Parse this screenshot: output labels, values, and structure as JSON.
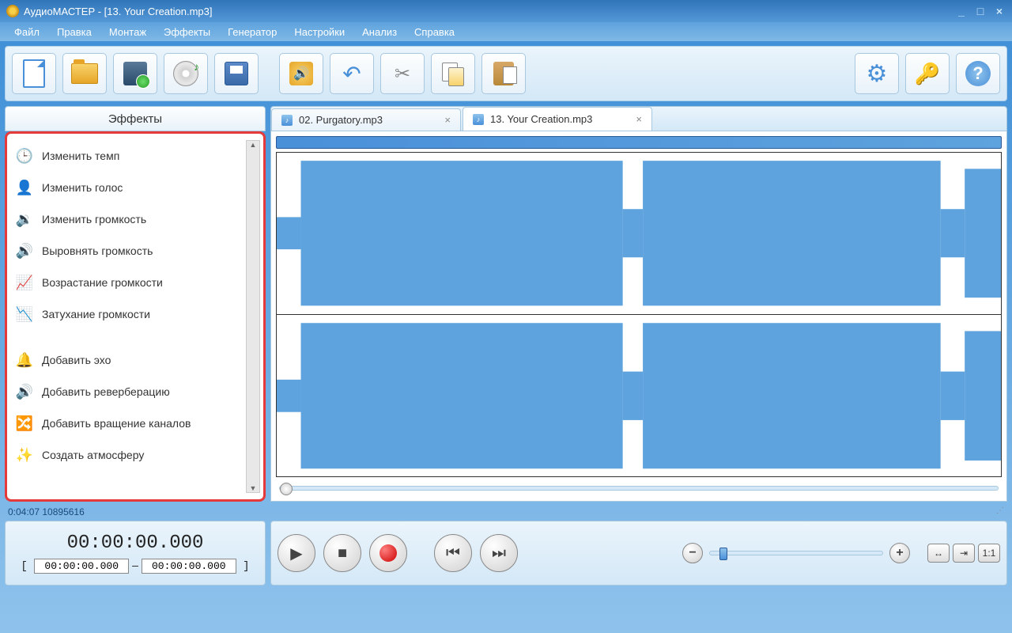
{
  "window": {
    "title": "АудиоМАСТЕР - [13. Your Creation.mp3]"
  },
  "menu": {
    "items": [
      "Файл",
      "Правка",
      "Монтаж",
      "Эффекты",
      "Генератор",
      "Настройки",
      "Анализ",
      "Справка"
    ]
  },
  "toolbar": {
    "new": "new",
    "open": "open",
    "video": "video",
    "cd": "cd",
    "save": "save",
    "speaker": "speaker",
    "undo": "undo",
    "cut": "cut",
    "copy": "copy",
    "paste": "paste",
    "settings": "settings",
    "keys": "keys",
    "help": "help"
  },
  "effects": {
    "header": "Эффекты",
    "items": [
      {
        "icon": "🕒",
        "label": "Изменить темп"
      },
      {
        "icon": "👤",
        "label": "Изменить голос"
      },
      {
        "icon": "🔉",
        "label": "Изменить громкость"
      },
      {
        "icon": "🔊",
        "label": "Выровнять громкость"
      },
      {
        "icon": "📈",
        "label": "Возрастание громкости"
      },
      {
        "icon": "📉",
        "label": "Затухание громкости"
      }
    ],
    "items2": [
      {
        "icon": "🔔",
        "label": "Добавить эхо"
      },
      {
        "icon": "🔊",
        "label": "Добавить реверберацию"
      },
      {
        "icon": "🔀",
        "label": "Добавить вращение каналов"
      },
      {
        "icon": "✨",
        "label": "Создать атмосферу"
      }
    ]
  },
  "tabs": [
    {
      "label": "02. Purgatory.mp3",
      "active": false
    },
    {
      "label": "13. Your Creation.mp3",
      "active": true
    }
  ],
  "status": {
    "text": "0:04:07 10895616"
  },
  "time": {
    "current": "00:00:00.000",
    "from": "00:00:00.000",
    "to": "00:00:00.000",
    "sep": " – "
  },
  "transport": {
    "play": "▶",
    "stop": "■",
    "prev": "⏮",
    "next": "⏭",
    "zoom_out": "−",
    "zoom_in": "+",
    "fit_h": "↔",
    "fit_sel": "⇥",
    "fit_11": "1:1"
  }
}
